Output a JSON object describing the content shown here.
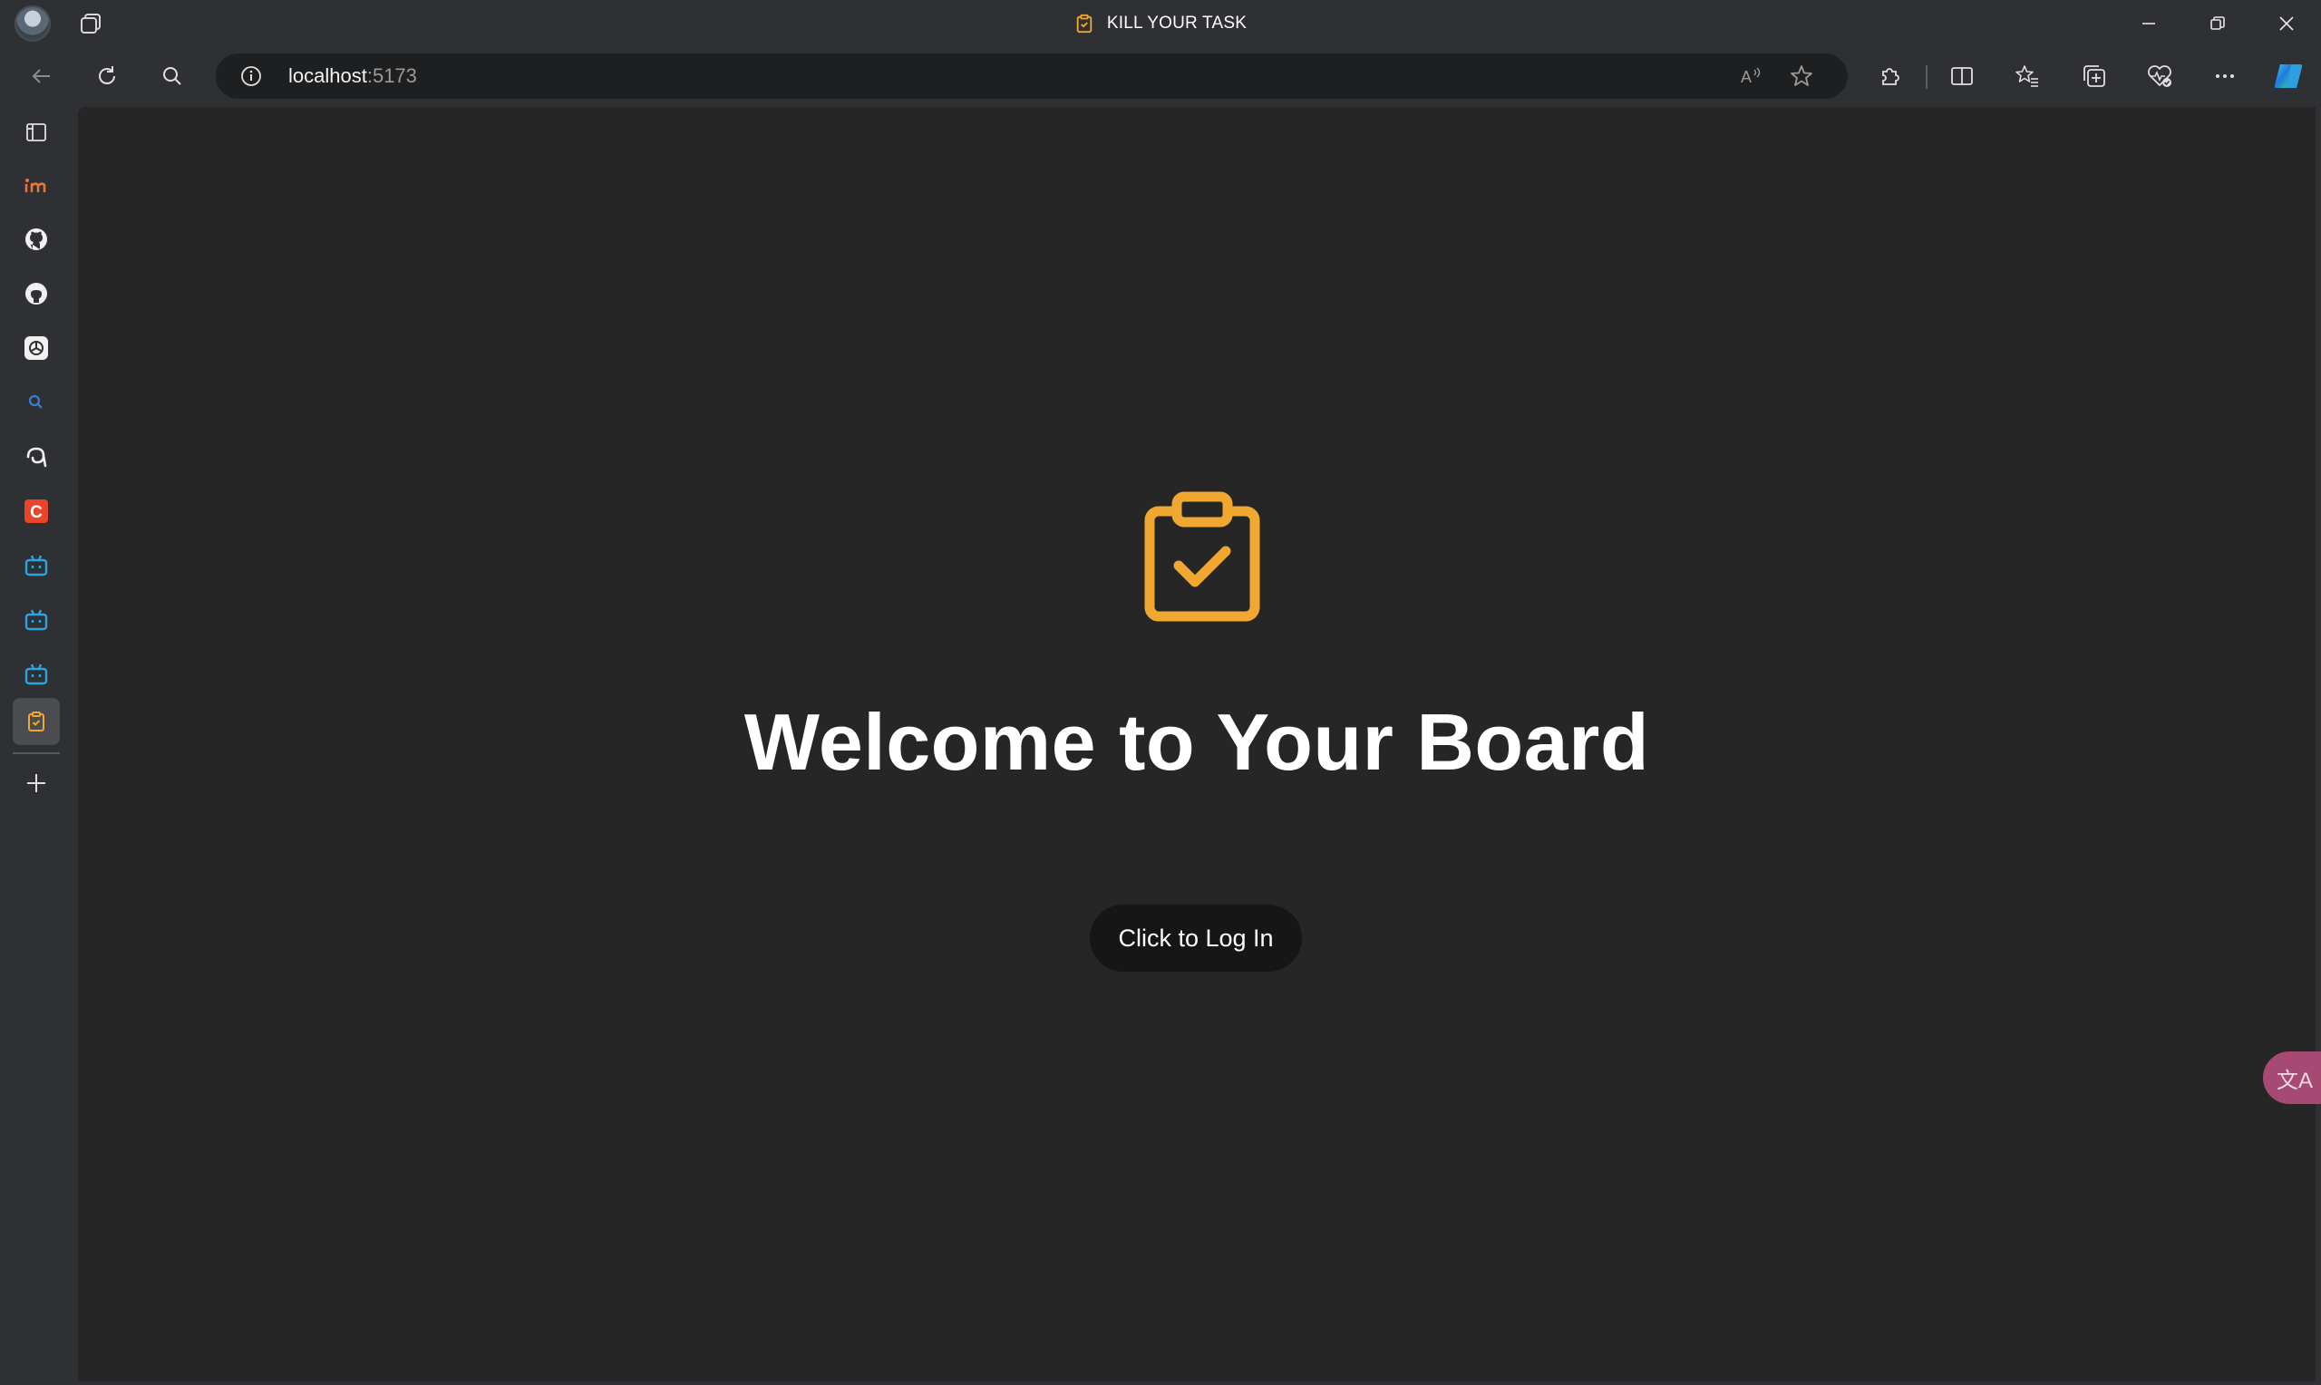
{
  "window": {
    "title": "KILL YOUR TASK",
    "controls": [
      "minimize-icon",
      "restore-icon",
      "close-icon"
    ]
  },
  "toolbar": {
    "url_host": "localhost",
    "url_port": ":5173",
    "icons": [
      "back-icon",
      "refresh-icon",
      "search-icon",
      "site-info-icon",
      "read-aloud-icon",
      "favorite-star-icon",
      "extensions-icon",
      "split-screen-icon",
      "favorites-icon",
      "collections-icon",
      "browser-essentials-icon",
      "more-icon",
      "copilot-icon"
    ]
  },
  "sidebar": {
    "items": [
      {
        "name": "vertical-tabs-icon"
      },
      {
        "name": "invision-icon"
      },
      {
        "name": "github-icon"
      },
      {
        "name": "github-alt-icon"
      },
      {
        "name": "openai-icon"
      },
      {
        "name": "search-site-icon"
      },
      {
        "name": "app-icon"
      },
      {
        "name": "c-app-icon"
      },
      {
        "name": "bilibili-icon"
      },
      {
        "name": "bilibili-icon"
      },
      {
        "name": "bilibili-icon"
      },
      {
        "name": "clipboard-check-icon",
        "active": true
      }
    ],
    "add_icon": "plus-icon"
  },
  "main": {
    "icon": "clipboard-check-icon",
    "heading": "Welcome to Your Board",
    "login_label": "Click to Log In",
    "accent": "#f0a830"
  },
  "translate_fab": {
    "icon": "translate-icon",
    "glyph": "文A"
  }
}
